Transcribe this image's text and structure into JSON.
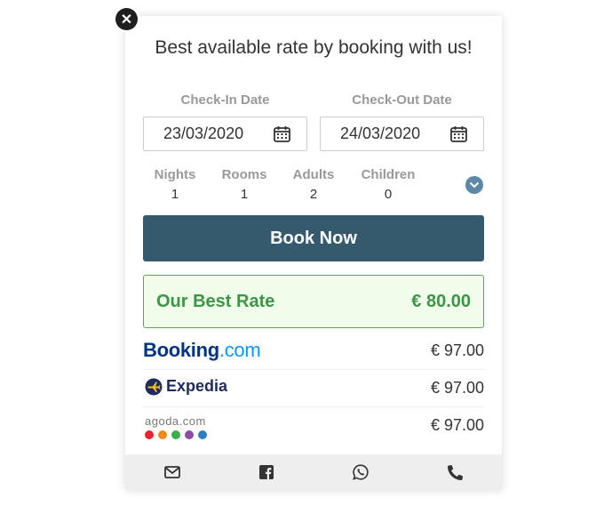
{
  "widget": {
    "title": "Best available rate by booking with us!",
    "close_icon": "close-icon",
    "checkin": {
      "label": "Check-In Date",
      "value": "23/03/2020",
      "icon": "calendar-icon"
    },
    "checkout": {
      "label": "Check-Out Date",
      "value": "24/03/2020",
      "icon": "calendar-icon"
    },
    "stats": [
      {
        "label": "Nights",
        "value": "1"
      },
      {
        "label": "Rooms",
        "value": "1"
      },
      {
        "label": "Adults",
        "value": "2"
      },
      {
        "label": "Children",
        "value": "0"
      }
    ],
    "expand_icon": "chevron-down-icon",
    "book_button": "Book Now",
    "best_rate": {
      "label": "Our Best Rate",
      "price": "€ 80.00"
    },
    "competitors": [
      {
        "name": "Booking.com",
        "logo_part1": "Booking",
        "logo_part2": ".com",
        "price": "€ 97.00"
      },
      {
        "name": "Expedia",
        "logo_text": "Expedia",
        "price": "€ 97.00"
      },
      {
        "name": "agoda.com",
        "logo_text": "agoda.com",
        "price": "€ 97.00"
      }
    ],
    "footer_icons": [
      "envelope-icon",
      "facebook-icon",
      "whatsapp-icon",
      "phone-icon"
    ]
  },
  "colors": {
    "primary": "#355a6e",
    "best_rate_green": "#3e9447",
    "best_rate_bg": "#effdea",
    "booking_blue": "#003580",
    "booking_light_blue": "#0896ff",
    "expedia_navy": "#1e2b5e",
    "expedia_yellow": "#f9c20a",
    "agoda_dots": [
      "#e8232b",
      "#f08a1b",
      "#3aae49",
      "#8e4aa6",
      "#2d7ec4"
    ]
  }
}
